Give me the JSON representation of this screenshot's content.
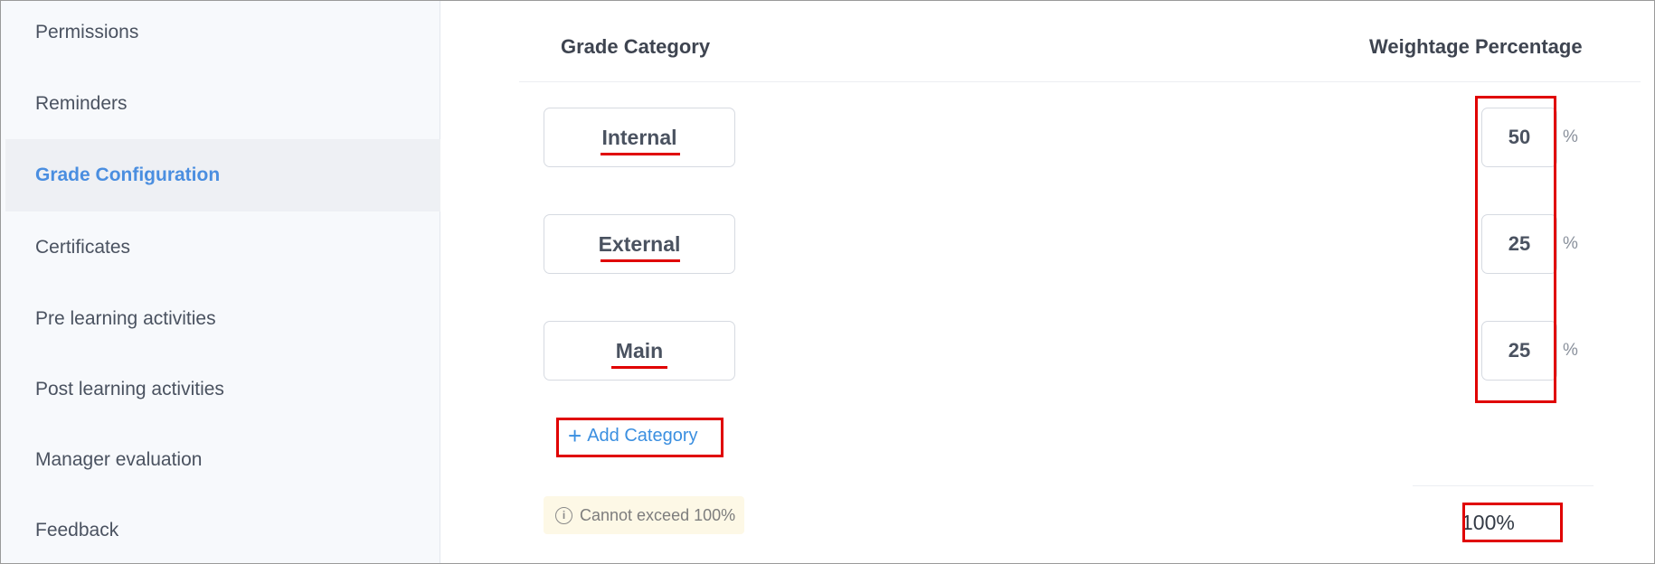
{
  "sidebar": {
    "items": [
      {
        "label": "Permissions"
      },
      {
        "label": "Reminders"
      },
      {
        "label": "Grade Configuration",
        "active": true
      },
      {
        "label": "Certificates"
      },
      {
        "label": "Pre learning activities"
      },
      {
        "label": "Post learning activities"
      },
      {
        "label": "Manager evaluation"
      },
      {
        "label": "Feedback"
      }
    ]
  },
  "table": {
    "header_category": "Grade Category",
    "header_weightage": "Weightage Percentage",
    "rows": [
      {
        "category": "Internal",
        "percentage": "50",
        "unit": "%"
      },
      {
        "category": "External",
        "percentage": "25",
        "unit": "%"
      },
      {
        "category": "Main",
        "percentage": "25",
        "unit": "%"
      }
    ],
    "add_category_label": "Add Category",
    "add_icon": "+",
    "note_icon": "i",
    "note_text": "Cannot exceed 100%",
    "total": "100%"
  },
  "colors": {
    "accent": "#3b8fe0",
    "active_nav": "#4a8ee0",
    "highlight": "#e00000",
    "note_bg": "#fdf8e6"
  }
}
